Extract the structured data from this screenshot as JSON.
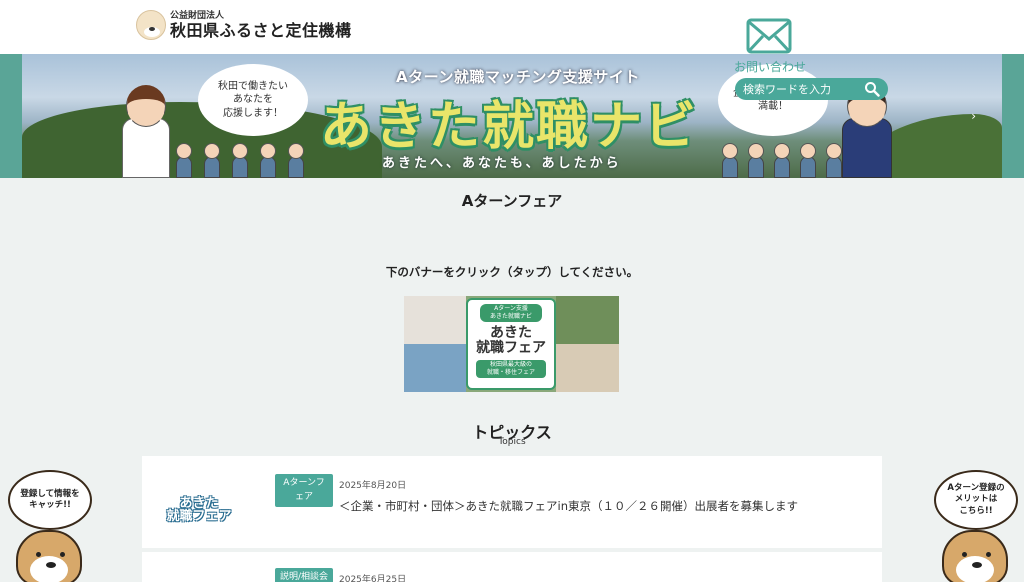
{
  "header": {
    "logo_sub": "公益財団法人",
    "logo_main": "秋田県ふるさと定住機構",
    "contact_label": "お問い合わせ",
    "search_placeholder": "検索ワードを入力"
  },
  "hero": {
    "bubble_left": "秋田で働きたい\nあなたを\n応援します！",
    "bubble_right": "企業・求人情報が\n満載！",
    "subtitle": "Aターン就職マッチング支援サイト",
    "title": "あきた就職ナビ",
    "tagline": "あきたへ、あなたも、あしたから",
    "next_arrow": "›"
  },
  "main": {
    "page_title": "Aターンフェア",
    "instruction": "下のバナーをクリック（タップ）してください。",
    "fair_banner": {
      "top_label": "Aターン支援\nあきた就職ナビ",
      "title": "あきた\n就職フェア",
      "bottom_label": "秋田県最大級の\n就職・移住フェア"
    }
  },
  "topics": {
    "title": "トピックス",
    "subtitle": "Topics",
    "items": [
      {
        "badge": "Aターンフェア",
        "date": "2025年8月20日",
        "title": "＜企業・市町村・団体＞あきた就職フェアin東京（１０／２６開催）出展者を募集します",
        "thumb_text": "あきた\n就職フェア"
      },
      {
        "badge": "説明/相談会",
        "date": "2025年6月25日",
        "title": ""
      }
    ]
  },
  "floating": {
    "left_bubble": "登録して情報を\nキャッチ!!",
    "right_bubble": "Aターン登録の\nメリットは\nこちら!!"
  },
  "colors": {
    "accent": "#4aa89a",
    "background": "#eef2f1",
    "hero_frame": "#5aa597"
  }
}
